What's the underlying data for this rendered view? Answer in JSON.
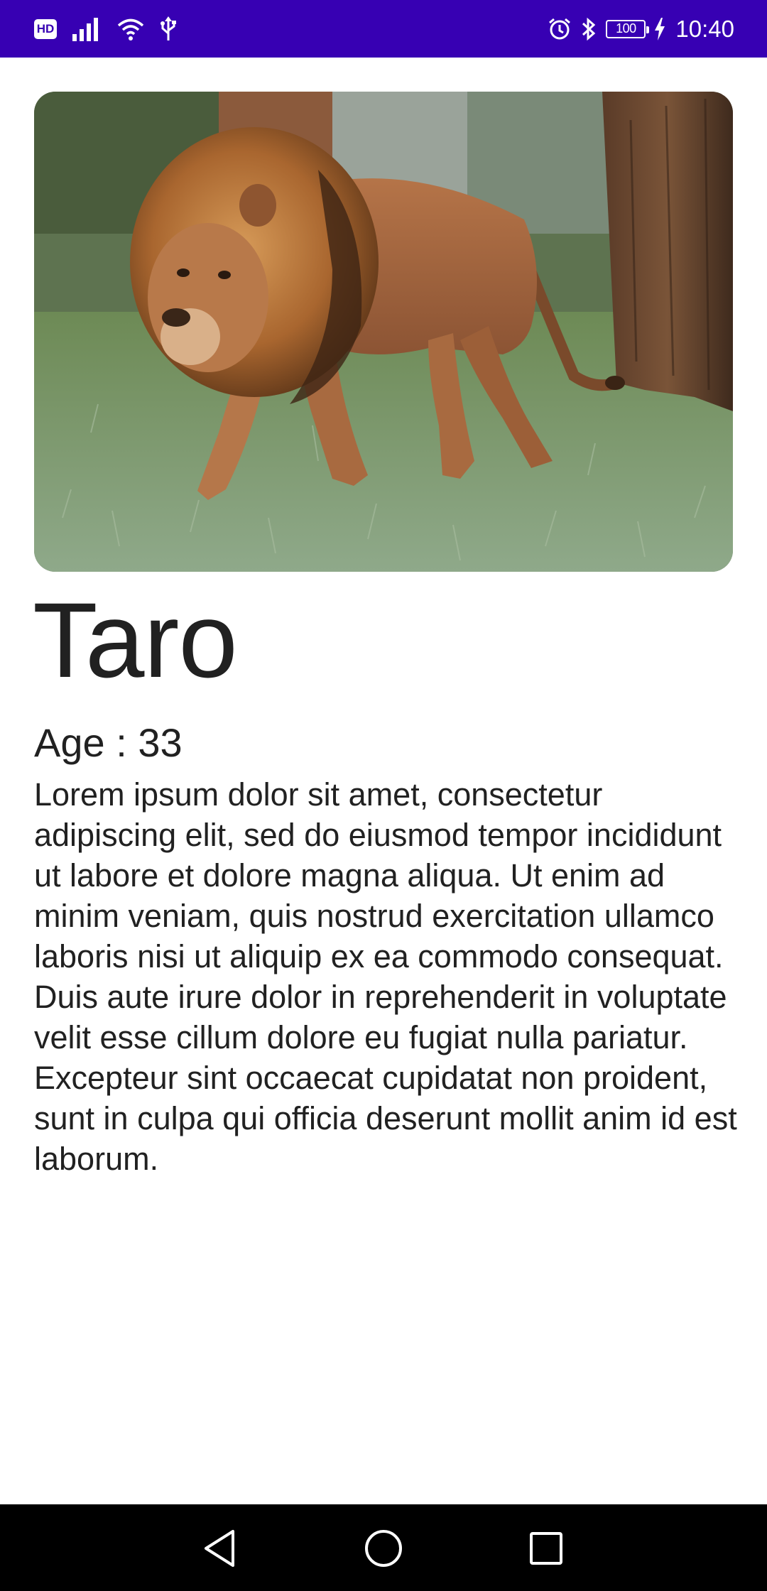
{
  "status_bar": {
    "time": "10:40",
    "battery": "100",
    "hd_label": "HD",
    "icons": [
      "hd-icon",
      "signal-icon",
      "wifi-icon",
      "usb-icon",
      "alarm-icon",
      "bluetooth-icon",
      "battery-icon",
      "charging-icon"
    ]
  },
  "colors": {
    "status_bar_bg": "#3700b3",
    "nav_bar_bg": "#000000",
    "text": "#212121"
  },
  "hero_image": {
    "subject": "lion-photo"
  },
  "animal": {
    "name": "Taro",
    "age_line": "Age : 33",
    "description": "Lorem ipsum dolor sit amet, consectetur adipiscing elit, sed do eiusmod tempor incididunt ut labore et dolore magna aliqua. Ut enim ad minim veniam, quis nostrud exercitation ullamco laboris nisi ut aliquip ex ea commodo consequat. Duis aute irure dolor in reprehenderit in voluptate velit esse cillum dolore eu fugiat nulla pariatur. Excepteur sint occaecat cupidatat non proident, sunt in culpa qui officia deserunt mollit anim id est laborum."
  },
  "nav_bar": {
    "buttons": [
      "back-icon",
      "home-icon",
      "recents-icon"
    ]
  }
}
